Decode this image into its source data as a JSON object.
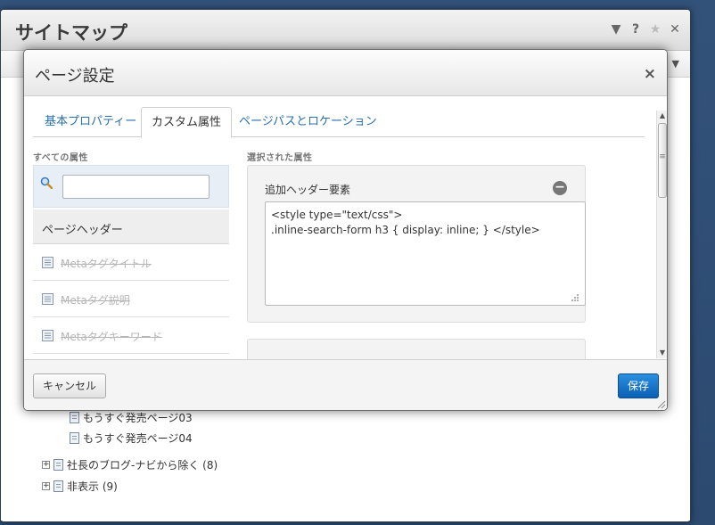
{
  "background_window": {
    "title": "サイトマップ",
    "controls": [
      "▼",
      "?",
      "★",
      "✕"
    ],
    "tree": [
      {
        "label": "もうすぐ発売ページ03",
        "type": "page"
      },
      {
        "label": "もうすぐ発売ページ04",
        "type": "page"
      },
      {
        "label": "社長のブログ-ナビから除く (8)",
        "type": "folder"
      },
      {
        "label": "非表示 (9)",
        "type": "folder"
      }
    ]
  },
  "modal": {
    "title": "ページ設定",
    "close_glyph": "×",
    "tabs": [
      {
        "label": "基本プロパティー",
        "active": false
      },
      {
        "label": "カスタム属性",
        "active": true
      },
      {
        "label": "ページパスとロケーション",
        "active": false
      }
    ],
    "all_attributes_label": "すべての属性",
    "search": {
      "value": "",
      "placeholder": ""
    },
    "attribute_group_header": "ページヘッダー",
    "attributes": [
      {
        "label": "Metaタグタイトル",
        "disabled": true
      },
      {
        "label": "Metaタグ説明",
        "disabled": true
      },
      {
        "label": "Metaタグキーワード",
        "disabled": true
      }
    ],
    "selected_attributes_label": "選択された属性",
    "selected_attribute": {
      "title": "追加ヘッダー要素",
      "remove_glyph": "−",
      "value": "<style type=\"text/css\">\n.inline-search-form h3 { display: inline; } </style>"
    },
    "footer": {
      "cancel_label": "キャンセル",
      "save_label": "保存"
    }
  },
  "colors": {
    "link": "#2a6fb0",
    "primary_button": "#1976c9",
    "desktop": "#2c4a70"
  }
}
